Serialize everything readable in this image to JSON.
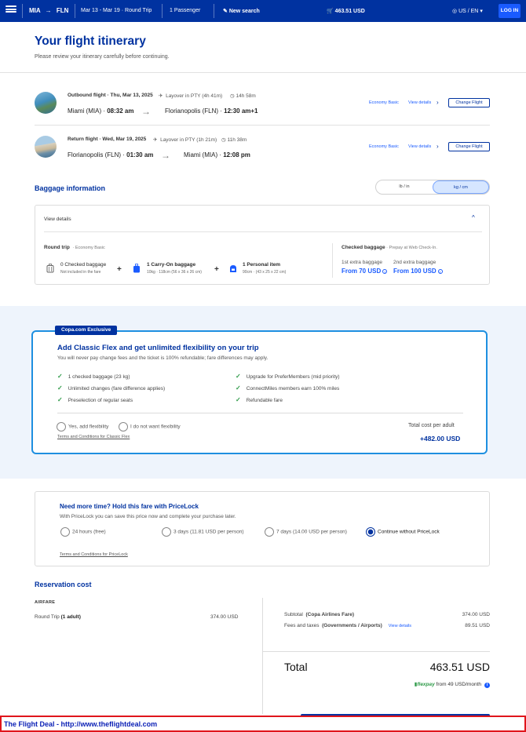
{
  "header": {
    "origin": "MIA",
    "destination": "FLN",
    "route_arrow": "→",
    "dates": "Mar 13 - Mar 19 · Round Trip",
    "passengers": "1 Passenger",
    "new_search": "New search",
    "price": "463.51 USD",
    "language": "US / EN",
    "login": "LOG IN"
  },
  "page": {
    "title": "Your flight itinerary",
    "subtitle": "Please review your itinerary carefully before continuing."
  },
  "flights": [
    {
      "title": "Outbound flight · Thu, Mar 13, 2025",
      "layover": "Layover in PTY (4h 41m)",
      "duration": "14h 58m",
      "from": "Miami (MIA) · ",
      "from_time": "08:32 am",
      "to": "Florianopolis (FLN) · ",
      "to_time": "12:30 am+1",
      "fare": "Economy Basic",
      "view_details": "View details",
      "change": "Change Flight"
    },
    {
      "title": "Return flight · Wed, Mar 19, 2025",
      "layover": "Layover in PTY (1h 21m)",
      "duration": "11h 38m",
      "from": "Florianopolis (FLN) · ",
      "from_time": "01:30 am",
      "to": "Miami (MIA) · ",
      "to_time": "12:08 pm",
      "fare": "Economy Basic",
      "view_details": "View details",
      "change": "Change Flight"
    }
  ],
  "baggage": {
    "title": "Baggage information",
    "unit_lb": "lb / in",
    "unit_kg": "kg / cm",
    "view_details": "View details",
    "round_trip": "Round trip",
    "round_trip_fare": "· Economy Basic",
    "items": [
      {
        "title": "0 Checked baggage",
        "sub": "Not included in the fare"
      },
      {
        "title": "1 Carry-On baggage",
        "sub": "10kg · 118cm (56 x 36 x 26 cm)"
      },
      {
        "title": "1 Personal item",
        "sub": "90cm · (43 x 25 x 22 cm)"
      }
    ],
    "plus": "+",
    "checked_title": "Checked baggage",
    "checked_sub": " · Prepay at Web Check-In.",
    "extra1_label": "1st extra baggage",
    "extra1_value": "From 70 USD",
    "extra2_label": "2nd extra baggage",
    "extra2_value": "From 100 USD"
  },
  "flex": {
    "badge": "Copa.com Exclusive",
    "title": "Add Classic Flex and get unlimited flexibility on your trip",
    "subtitle": "You will never pay change fees and the ticket is 100% refundable; fare differences may apply.",
    "features_left": [
      "1 checked baggage (23 kg)",
      "Unlimited changes (fare difference applies)",
      "Preselection of regular seats"
    ],
    "features_right": [
      "Upgrade for PreferMembers (mid priority)",
      "ConnectMiles members earn 100% miles",
      "Refundable fare"
    ],
    "check": "✓",
    "option_yes": "Yes, add flexibility",
    "option_no": "I do not want flexibility",
    "terms": "Terms and Conditions for Classic Flex",
    "total_label": "Total cost per adult",
    "total_value": "+482.00 USD"
  },
  "pricelock": {
    "title": "Need more time? Hold this fare with PriceLock",
    "subtitle": "With PriceLock you can save this price now and complete your purchase later.",
    "options": [
      "24 hours (free)",
      "3 days (11.81 USD per person)",
      "7 days (14.00 USD per person)",
      "Continue without PriceLock"
    ],
    "selected_index": 3,
    "terms": "Terms and Conditions for PriceLock"
  },
  "reservation": {
    "title": "Reservation cost",
    "airfare": "AIRFARE",
    "round_trip": "Round Trip",
    "round_trip_adult": "(1 adult)",
    "round_trip_value": "374.00 USD",
    "subtotal_label": "Subtotal",
    "subtotal_detail": "(Copa Airlines Fare)",
    "subtotal_value": "374.00 USD",
    "fees_label": "Fees and taxes",
    "fees_detail": "(Governments / Airports)",
    "fees_view": "View details",
    "fees_value": "89.51 USD",
    "total_label": "Total",
    "total_value": "463.51 USD",
    "flexpay_brand": "flexpay",
    "flexpay_text": " from 49 USD/month",
    "info": "i"
  },
  "banner": {
    "text": "The Flight Deal - http://www.theflightdeal.com"
  },
  "colors": {
    "brand": "#0032a0",
    "accent": "#1a5bff",
    "check": "#2e9a48",
    "banner_border": "#e0151b"
  }
}
